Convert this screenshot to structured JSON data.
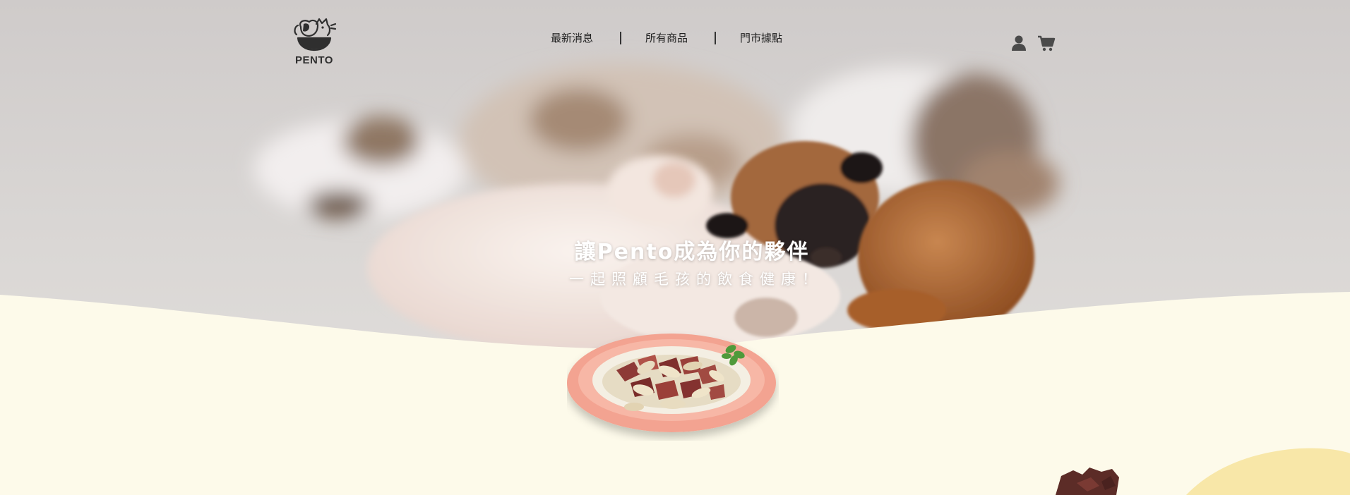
{
  "brand": {
    "logo_text": "PENTO",
    "logo_icon": "cat-dog-bowl-logo"
  },
  "nav": {
    "items": [
      {
        "label": "最新消息"
      },
      {
        "label": "所有商品"
      },
      {
        "label": "門市據點"
      }
    ]
  },
  "actions": {
    "account_icon": "user-icon",
    "cart_icon": "shopping-cart-icon"
  },
  "hero": {
    "headline": "讓Pento成為你的夥伴",
    "subheadline": "一起照顧毛孩的飲食健康！"
  },
  "colors": {
    "cream": "#fdfaea",
    "accent_yellow": "#f8e7a8",
    "plate_pink": "#f3a391",
    "text_dark": "#222222"
  }
}
